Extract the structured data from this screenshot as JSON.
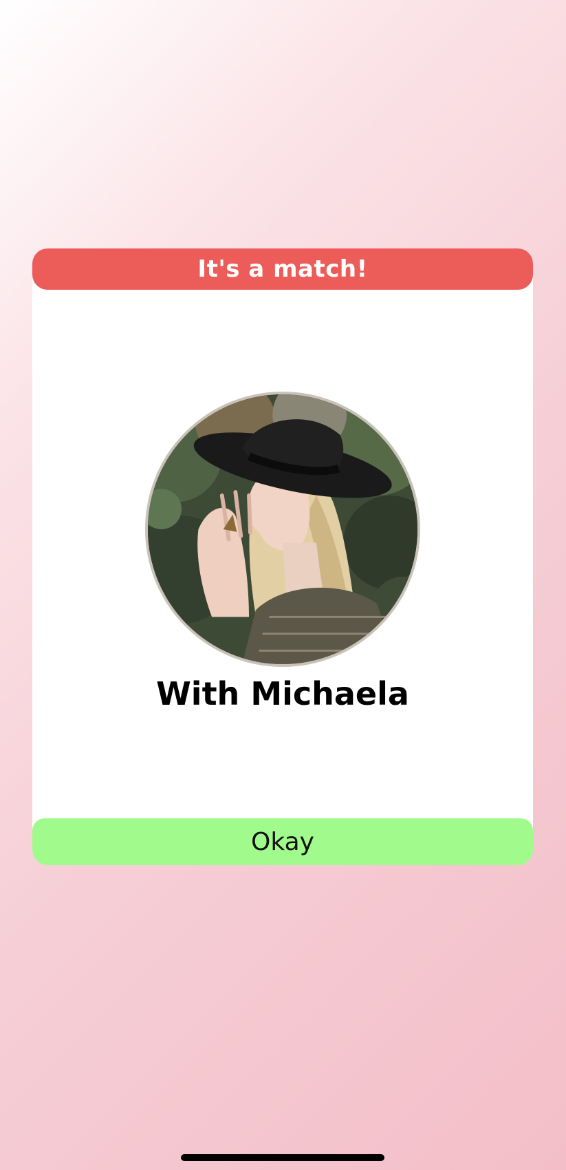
{
  "dialog": {
    "title": "It's a match!",
    "match_name": "With Michaela",
    "okay_label": "Okay"
  },
  "colors": {
    "header": "#ec5c58",
    "button": "#a1fb8c",
    "card": "#ffffff",
    "background_start": "#ffffff",
    "background_end": "#f3bec8"
  },
  "icons": {
    "avatar": "profile-photo"
  }
}
